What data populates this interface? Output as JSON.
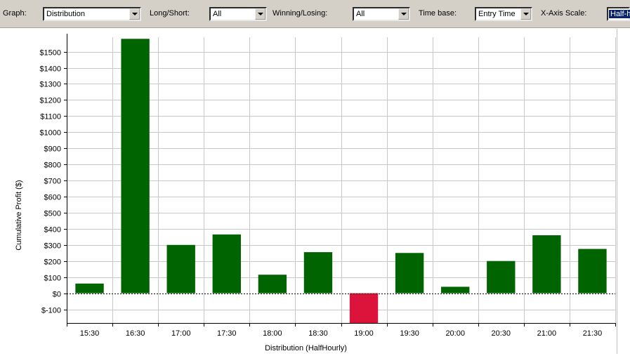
{
  "toolbar": {
    "graph_label": "Graph:",
    "graph_value": "Distribution",
    "longshort_label": "Long/Short:",
    "longshort_value": "All",
    "winlose_label": "Winning/Losing:",
    "winlose_value": "All",
    "timebase_label": "Time base:",
    "timebase_value": "Entry Time",
    "xscale_label": "X-Axis Scale:",
    "xscale_value": "Half-h"
  },
  "chart_data": {
    "type": "bar",
    "xlabel": "Distribution (HalfHourly)",
    "ylabel": "Cumulative Profit ($)",
    "categories": [
      "15:30",
      "16:30",
      "17:00",
      "17:30",
      "18:00",
      "18:30",
      "19:00",
      "19:30",
      "20:00",
      "20:30",
      "21:00",
      "21:30"
    ],
    "values": [
      60,
      1580,
      300,
      365,
      115,
      255,
      -185,
      250,
      40,
      200,
      360,
      275
    ],
    "ylim": [
      -185,
      1590
    ],
    "yticks": [
      -100,
      0,
      100,
      200,
      300,
      400,
      500,
      600,
      700,
      800,
      900,
      1000,
      1100,
      1200,
      1300,
      1400,
      1500
    ],
    "ytick_labels": [
      "$-100",
      "$0",
      "$100",
      "$200",
      "$300",
      "$400",
      "$500",
      "$600",
      "$700",
      "$800",
      "$900",
      "$1000",
      "$1100",
      "$1200",
      "$1300",
      "$1400",
      "$1500"
    ],
    "grid": true,
    "colors": {
      "positive": "#006400",
      "negative": "#dc143c",
      "grid": "#c8c8c8"
    }
  }
}
